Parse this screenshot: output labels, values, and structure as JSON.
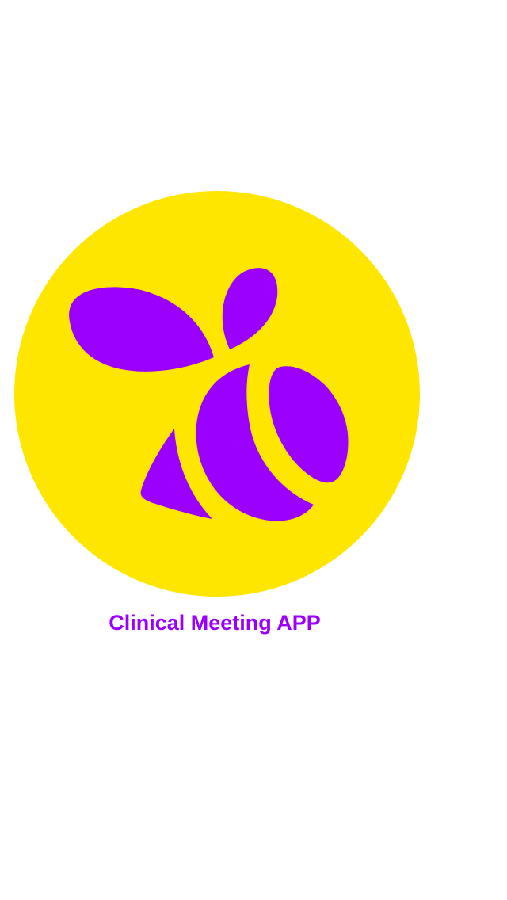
{
  "app": {
    "title": "Clinical Meeting APP"
  },
  "logo": {
    "icon": "bee-logo-icon",
    "circle_color": "#FFE600",
    "bee_color": "#9B00FF"
  },
  "theme": {
    "background": "#FFFFFF",
    "title_color": "#9B00FF"
  }
}
